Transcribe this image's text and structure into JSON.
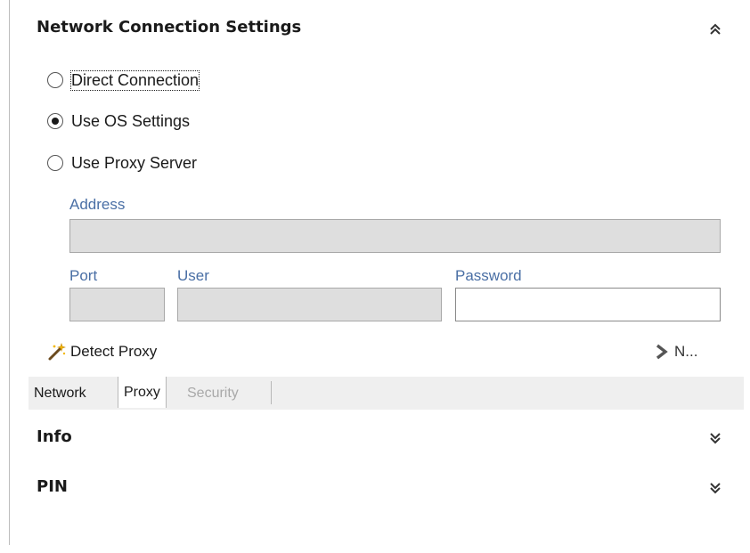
{
  "network_panel": {
    "title": "Network Connection Settings",
    "collapse_icon": "double-chevron-up-icon",
    "options": [
      {
        "label": "Direct Connection",
        "checked": false,
        "focused": true
      },
      {
        "label": "Use OS Settings",
        "checked": true,
        "focused": false
      },
      {
        "label": "Use Proxy Server",
        "checked": false,
        "focused": false
      }
    ],
    "address": {
      "label": "Address",
      "value": ""
    },
    "port": {
      "label": "Port",
      "value": ""
    },
    "user": {
      "label": "User",
      "value": ""
    },
    "password": {
      "label": "Password",
      "value": ""
    },
    "detect_proxy": {
      "label": "Detect Proxy",
      "icon": "magic-wand-icon"
    },
    "next": {
      "label": "N...",
      "icon": "chevron-right-icon"
    }
  },
  "tabs": [
    {
      "label": "Network",
      "state": "normal"
    },
    {
      "label": "Proxy",
      "state": "active"
    },
    {
      "label": "Security",
      "state": "disabled"
    }
  ],
  "sections": [
    {
      "title": "Info",
      "expand_icon": "double-chevron-down-icon"
    },
    {
      "title": "PIN",
      "expand_icon": "double-chevron-down-icon"
    }
  ],
  "colors": {
    "field_label": "#4a6fa5",
    "disabled_field_bg": "#dedede",
    "tabstrip_bg": "#efefef",
    "disabled_text": "#a9a9a9"
  }
}
